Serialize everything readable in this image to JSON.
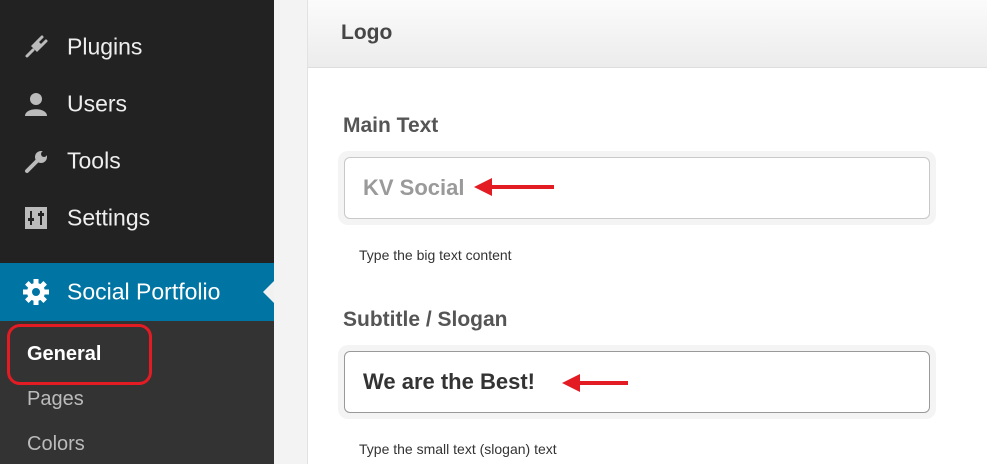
{
  "sidebar": {
    "items": [
      {
        "label": "Plugins",
        "icon": "plugin-icon"
      },
      {
        "label": "Users",
        "icon": "user-icon"
      },
      {
        "label": "Tools",
        "icon": "wrench-icon"
      },
      {
        "label": "Settings",
        "icon": "settings-icon"
      }
    ],
    "active_item": {
      "label": "Social Portfolio",
      "icon": "gear-icon"
    },
    "submenu": [
      {
        "label": "General",
        "current": true
      },
      {
        "label": "Pages"
      },
      {
        "label": "Colors"
      }
    ]
  },
  "section": {
    "title": "Logo"
  },
  "fields": [
    {
      "label": "Main Text",
      "value": "KV Social",
      "helper": "Type the big text content"
    },
    {
      "label": "Subtitle / Slogan",
      "value": "We are the Best!",
      "helper": "Type the small text (slogan) text"
    }
  ],
  "colors": {
    "sidebar_bg": "#222222",
    "active_bg": "#0074a2",
    "annotation_red": "#e31b23"
  }
}
